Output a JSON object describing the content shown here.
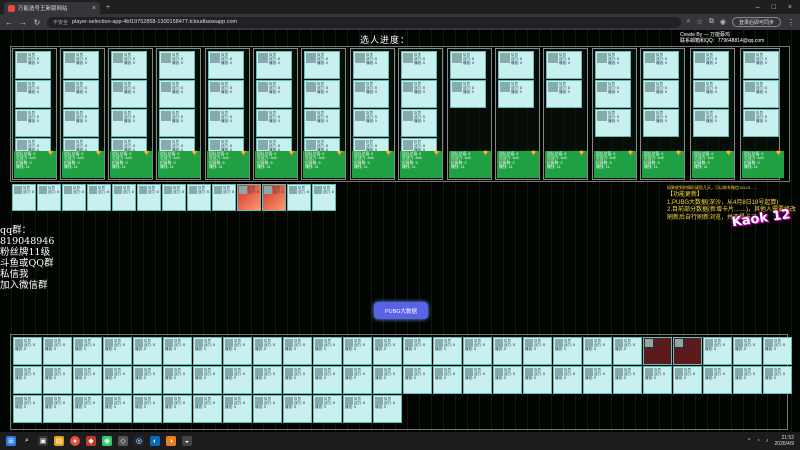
{
  "browser": {
    "tab_title": "万能选号王新版网站",
    "url_secure": "不安全",
    "url": "player-selection-app-4bf19752858-1300158477.tcloudbaseapp.com",
    "login_label": "登录后即可同步"
  },
  "page": {
    "title": "选人进度：",
    "creator_line1": "Create By — 万能蔡鸡",
    "creator_line2": "联系邮箱和QQ：779648814@qq.com"
  },
  "team_info_lines": [
    "团队总值: 5",
    "总战力: 642",
    "招募数: 5",
    "赚钱: 11"
  ],
  "qq": {
    "line1": "qq群：",
    "line2": "819048946",
    "line3": "粉丝牌11级",
    "line4": "斗鱼或QQ群",
    "line5": "私信我",
    "line6": "加入微信群"
  },
  "notice": {
    "head": "如果收到的情形请您几天，可以联系微信15123……",
    "title": "【功能更新】",
    "item1": "1.PUBG大数据(深沙，从4月8日18号起算)",
    "item2": "2.目前部分数据(新增卡片……)，其他人需要修改刷新后自行刷新浏览，并不是卡了"
  },
  "badge": "Kaok 12",
  "pubg_button": "PUBG大数据",
  "card_text": {
    "name": "队员",
    "line2": "战力: 8",
    "line3": "赚钱: 5"
  },
  "taskbar": {
    "time": "21:52",
    "date": "2026/4/9"
  }
}
